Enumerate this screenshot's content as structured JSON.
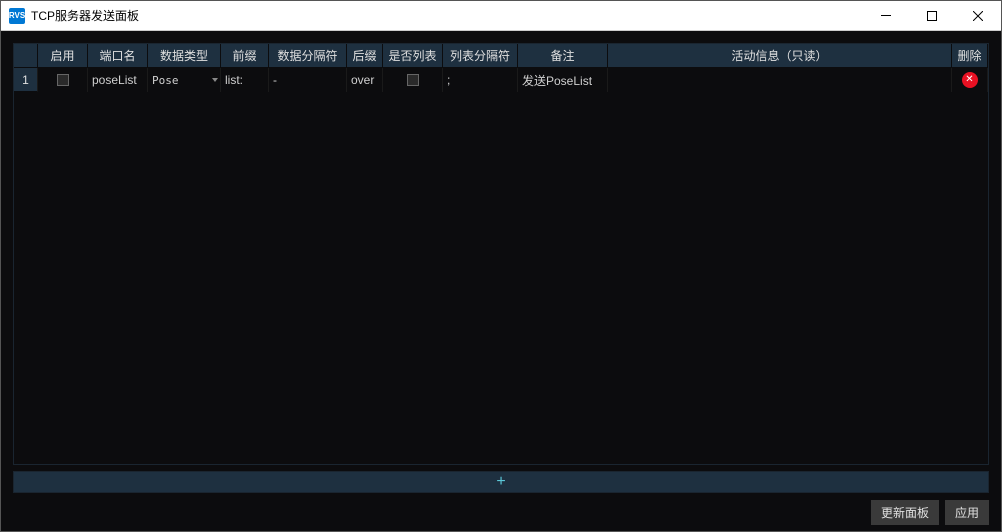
{
  "window": {
    "title": "TCP服务器发送面板",
    "app_icon_text": "RVS"
  },
  "table": {
    "headers": {
      "rownum": "",
      "enable": "启用",
      "portname": "端口名",
      "datatype": "数据类型",
      "prefix": "前缀",
      "datasep": "数据分隔符",
      "suffix": "后缀",
      "islist": "是否列表",
      "listsep": "列表分隔符",
      "remark": "备注",
      "activity": "活动信息（只读）",
      "delete": "删除"
    },
    "rows": [
      {
        "rownum": "1",
        "enable": false,
        "portname": "poseList",
        "datatype": "Pose",
        "prefix": "list:",
        "datasep": "-",
        "suffix": "over",
        "islist": false,
        "listsep": ";",
        "remark": "发送PoseList",
        "activity": ""
      }
    ]
  },
  "addbar": {
    "symbol": "+"
  },
  "footer": {
    "update_panel": "更新面板",
    "apply": "应用"
  }
}
